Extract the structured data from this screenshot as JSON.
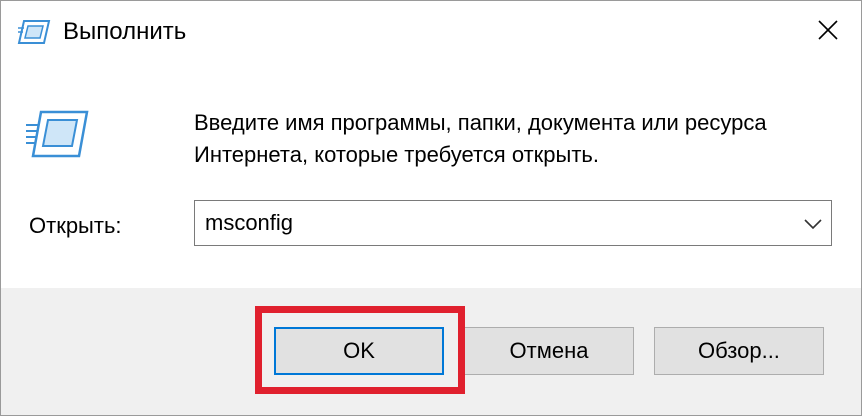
{
  "window": {
    "title": "Выполнить",
    "title_icon": "run-icon",
    "close_icon": "close-icon"
  },
  "main": {
    "icon": "run-icon",
    "description": "Введите имя программы, папки, документа или ресурса Интернета, которые требуется открыть.",
    "open_label": "Открыть:",
    "open_value": "msconfig",
    "dropdown_icon": "chevron-down-icon"
  },
  "buttons": {
    "ok": "OK",
    "cancel": "Отмена",
    "browse": "Обзор..."
  },
  "colors": {
    "highlight": "#e0202e",
    "focus_border": "#0078d7",
    "icon_blue": "#3a8fd6"
  }
}
